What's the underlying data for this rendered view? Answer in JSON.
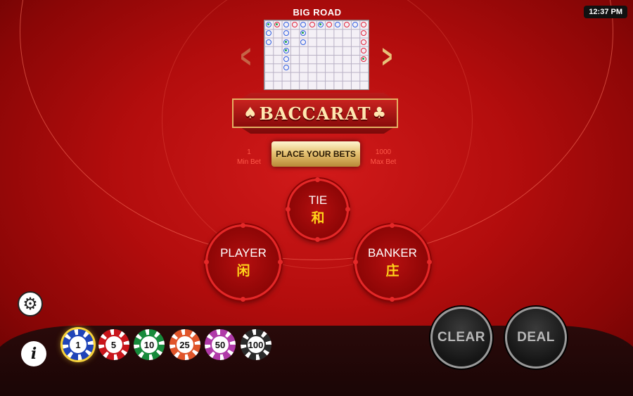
{
  "clock": "12:37 PM",
  "big_road": {
    "title": "BIG ROAD",
    "marks": [
      {
        "col": 0,
        "row": 0,
        "color": "blue",
        "dot": true
      },
      {
        "col": 0,
        "row": 1,
        "color": "blue",
        "dot": false
      },
      {
        "col": 0,
        "row": 2,
        "color": "blue",
        "dot": false
      },
      {
        "col": 1,
        "row": 0,
        "color": "red",
        "dot": true
      },
      {
        "col": 2,
        "row": 0,
        "color": "blue",
        "dot": false
      },
      {
        "col": 2,
        "row": 1,
        "color": "blue",
        "dot": false
      },
      {
        "col": 2,
        "row": 2,
        "color": "blue",
        "dot": true
      },
      {
        "col": 2,
        "row": 3,
        "color": "blue",
        "dot": true
      },
      {
        "col": 2,
        "row": 4,
        "color": "blue",
        "dot": false
      },
      {
        "col": 2,
        "row": 5,
        "color": "blue",
        "dot": false
      },
      {
        "col": 3,
        "row": 0,
        "color": "red",
        "dot": false
      },
      {
        "col": 4,
        "row": 0,
        "color": "blue",
        "dot": false
      },
      {
        "col": 4,
        "row": 1,
        "color": "blue",
        "dot": true
      },
      {
        "col": 4,
        "row": 2,
        "color": "blue",
        "dot": false
      },
      {
        "col": 5,
        "row": 0,
        "color": "red",
        "dot": false
      },
      {
        "col": 6,
        "row": 0,
        "color": "blue",
        "dot": true
      },
      {
        "col": 7,
        "row": 0,
        "color": "red",
        "dot": false
      },
      {
        "col": 8,
        "row": 0,
        "color": "blue",
        "dot": false
      },
      {
        "col": 9,
        "row": 0,
        "color": "red",
        "dot": false
      },
      {
        "col": 10,
        "row": 0,
        "color": "blue",
        "dot": false
      },
      {
        "col": 11,
        "row": 0,
        "color": "red",
        "dot": false
      },
      {
        "col": 11,
        "row": 1,
        "color": "red",
        "dot": false
      },
      {
        "col": 11,
        "row": 2,
        "color": "red",
        "dot": false
      },
      {
        "col": 11,
        "row": 3,
        "color": "red",
        "dot": false
      },
      {
        "col": 11,
        "row": 4,
        "color": "red",
        "dot": true
      }
    ]
  },
  "logo": {
    "text": "BACCARAT",
    "suit_left": "♠",
    "suit_right": "♣"
  },
  "limits": {
    "min_value": "1",
    "min_label": "Min Bet",
    "max_value": "1000",
    "max_label": "Max Bet"
  },
  "place_bets_label": "PLACE YOUR BETS",
  "bets": {
    "tie": {
      "en": "TIE",
      "zh": "和"
    },
    "player": {
      "en": "PLAYER",
      "zh": "闲"
    },
    "banker": {
      "en": "BANKER",
      "zh": "庄"
    }
  },
  "chips": [
    {
      "value": "1",
      "color": "#1f44b8",
      "selected": true
    },
    {
      "value": "5",
      "color": "#c8151b",
      "selected": false
    },
    {
      "value": "10",
      "color": "#178a3b",
      "selected": false
    },
    {
      "value": "25",
      "color": "#e0552a",
      "selected": false
    },
    {
      "value": "50",
      "color": "#b03aa8",
      "selected": false
    },
    {
      "value": "100",
      "color": "#2a2a2a",
      "selected": false
    }
  ],
  "actions": {
    "clear": "CLEAR",
    "deal": "DEAL"
  }
}
